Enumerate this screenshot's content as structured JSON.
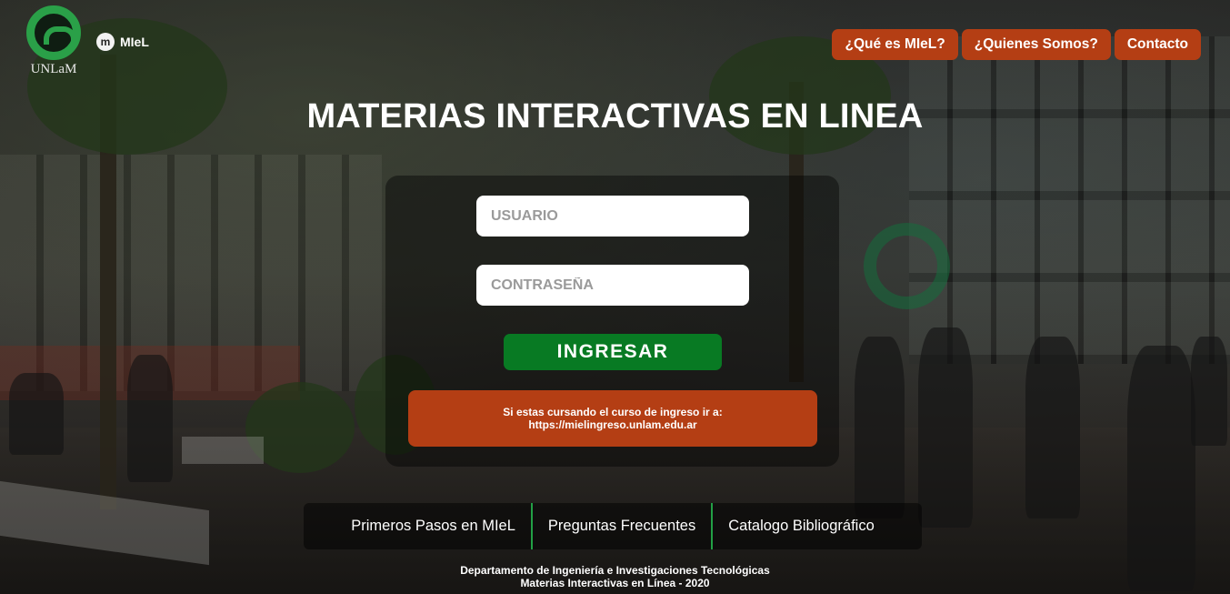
{
  "header": {
    "logo_text": "UNLaM",
    "miel_mark": "m",
    "miel_text": "MIeL",
    "nav": [
      {
        "label": "¿Qué es MIeL?"
      },
      {
        "label": "¿Quienes Somos?"
      },
      {
        "label": "Contacto"
      }
    ]
  },
  "page_title": "MATERIAS INTERACTIVAS EN LINEA",
  "login": {
    "username_placeholder": "USUARIO",
    "username_value": "",
    "password_placeholder": "CONTRASEÑA",
    "password_value": "",
    "submit_label": "INGRESAR"
  },
  "notice": {
    "line1": "Si estas cursando el curso de ingreso ir a:",
    "line2": "https://mielingreso.unlam.edu.ar"
  },
  "links": [
    {
      "label": "Primeros Pasos en MIeL"
    },
    {
      "label": "Preguntas Frecuentes"
    },
    {
      "label": "Catalogo Bibliográfico"
    }
  ],
  "footer": {
    "line1": "Departamento de Ingeniería e Investigaciones Tecnológicas",
    "line2": "Materias Interactivas en Línea - 2020"
  },
  "colors": {
    "accent_orange": "#b43e14",
    "accent_green": "#087a23",
    "brand_green": "#2aa048"
  }
}
